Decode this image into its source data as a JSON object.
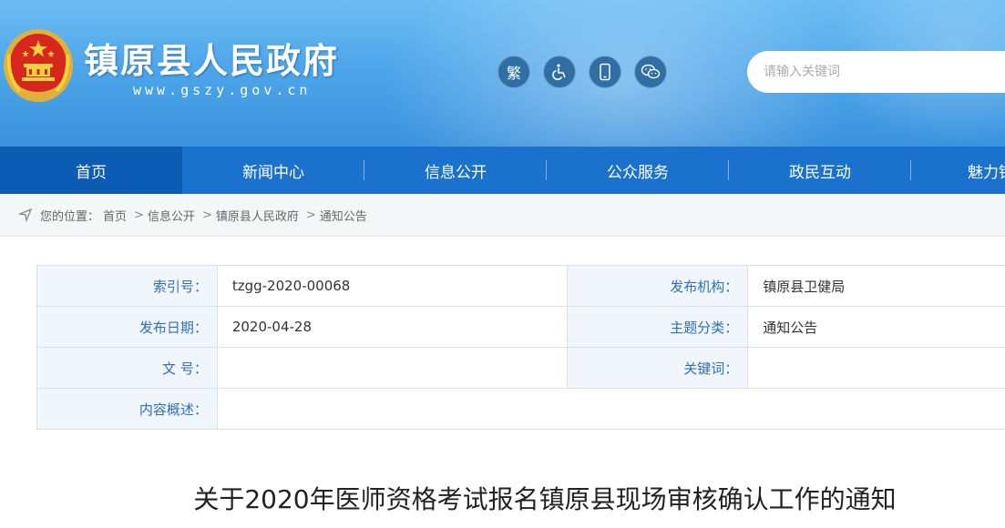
{
  "header": {
    "site_title": "镇原县人民政府",
    "site_url": "www.gszy.gov.cn",
    "tools": [
      {
        "label": "繁",
        "icon": "traditional-chinese-icon"
      },
      {
        "label": "",
        "icon": "accessibility-icon"
      },
      {
        "label": "",
        "icon": "mobile-icon"
      },
      {
        "label": "",
        "icon": "wechat-icon"
      }
    ],
    "search": {
      "placeholder": "请输入关键词",
      "value": ""
    }
  },
  "nav": {
    "items": [
      {
        "label": "首页",
        "active": true
      },
      {
        "label": "新闻中心",
        "active": false
      },
      {
        "label": "信息公开",
        "active": false
      },
      {
        "label": "公众服务",
        "active": false
      },
      {
        "label": "政民互动",
        "active": false
      },
      {
        "label": "魅力镇原",
        "active": false
      }
    ]
  },
  "breadcrumb": {
    "prefix": "您的位置：",
    "items": [
      "首页",
      "信息公开",
      "镇原县人民政府",
      "通知公告"
    ],
    "separator": ">"
  },
  "info": {
    "index_label": "索引号：",
    "index_value": "tzgg-2020-00068",
    "publisher_label": "发布机构：",
    "publisher_value": "镇原县卫健局",
    "date_label": "发布日期：",
    "date_value": "2020-04-28",
    "category_label": "主题分类：",
    "category_value": "通知公告",
    "doc_no_label": "文 号：",
    "doc_no_value": "",
    "keywords_label": "关键词：",
    "keywords_value": "",
    "summary_label": "内容概述：",
    "summary_value": ""
  },
  "article": {
    "title": "关于2020年医师资格考试报名镇原县现场审核确认工作的通知"
  },
  "colors": {
    "nav_bg": "#1a72cc",
    "nav_active": "#0d5cb3",
    "label_text": "#2e6fb5",
    "label_bg": "#f1f6fc"
  }
}
